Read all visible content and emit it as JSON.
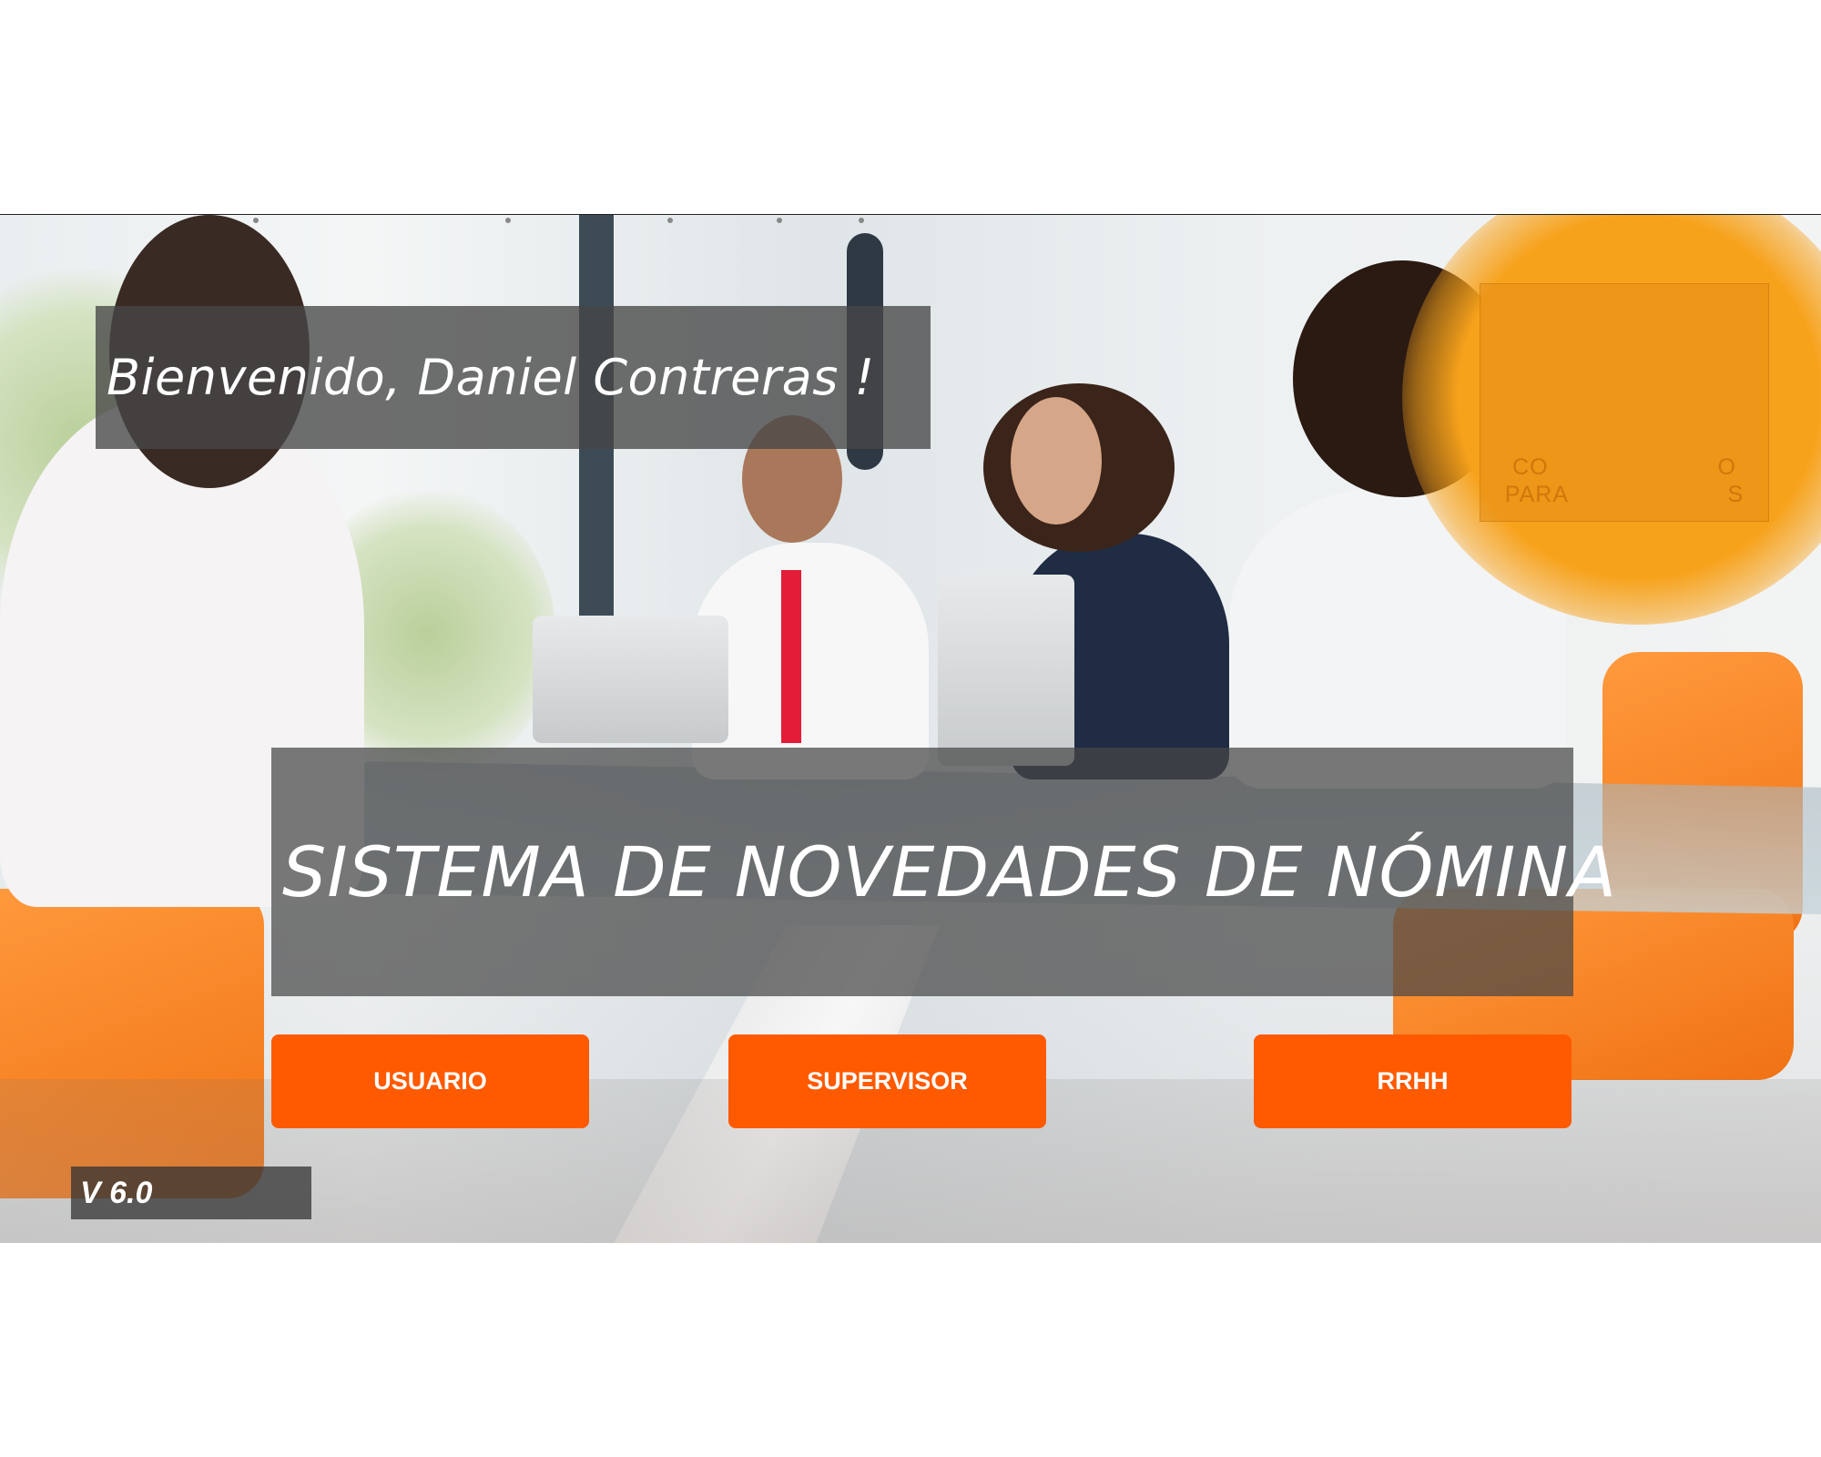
{
  "welcome": {
    "text": "Bienvenido, Daniel Contreras !"
  },
  "title": {
    "text": "SISTEMA DE NOVEDADES DE NÓMINA"
  },
  "buttons": {
    "usuario": "USUARIO",
    "supervisor": "SUPERVISOR",
    "rrhh": "RRHH"
  },
  "version": {
    "text": "V 6.0"
  },
  "badge": {
    "line1": "CO",
    "line1b": "O",
    "line2": "PARA",
    "line2b": "S"
  },
  "colors": {
    "accent": "#ff5a00",
    "badge": "#f7a21b",
    "panel": "#464646"
  }
}
